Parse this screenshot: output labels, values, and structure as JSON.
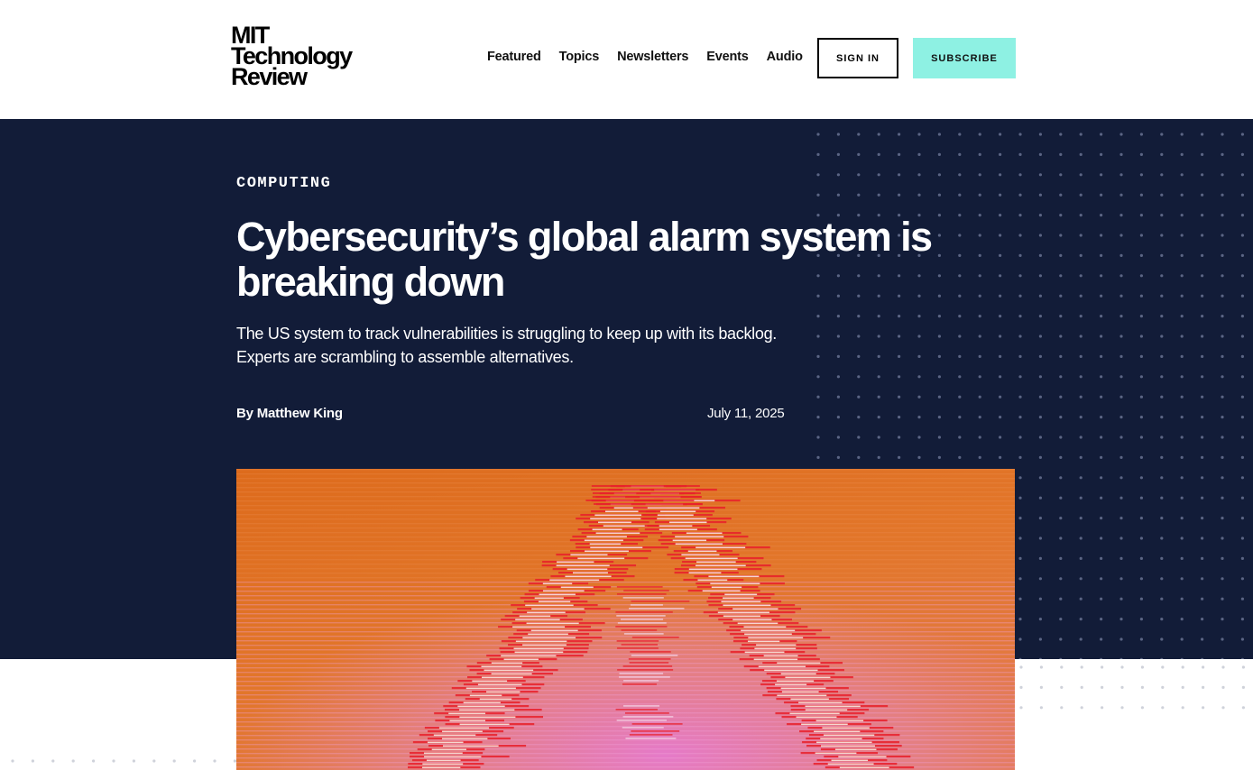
{
  "header": {
    "logo_line1": "MIT",
    "logo_line2": "Technology",
    "logo_line3": "Review",
    "nav": [
      "Featured",
      "Topics",
      "Newsletters",
      "Events",
      "Audio"
    ],
    "signin_label": "SIGN IN",
    "subscribe_label": "SUBSCRIBE"
  },
  "article": {
    "category": "COMPUTING",
    "headline": "Cybersecurity’s global alarm system is breaking down",
    "dek": "The US system to track vulnerabilities is struggling to keep up with its backlog. Experts are scrambling to assemble alternatives.",
    "byline_prefix": "By ",
    "author": "Matthew King",
    "date": "July 11, 2025"
  },
  "colors": {
    "hero_background": "#121c38",
    "subscribe_accent": "#8ef1e3",
    "image_orange": "#e0701f",
    "image_pink": "#e07ac4",
    "image_red": "#e8202a"
  },
  "image": {
    "description_icon": "warning-triangle-glitch-icon"
  }
}
